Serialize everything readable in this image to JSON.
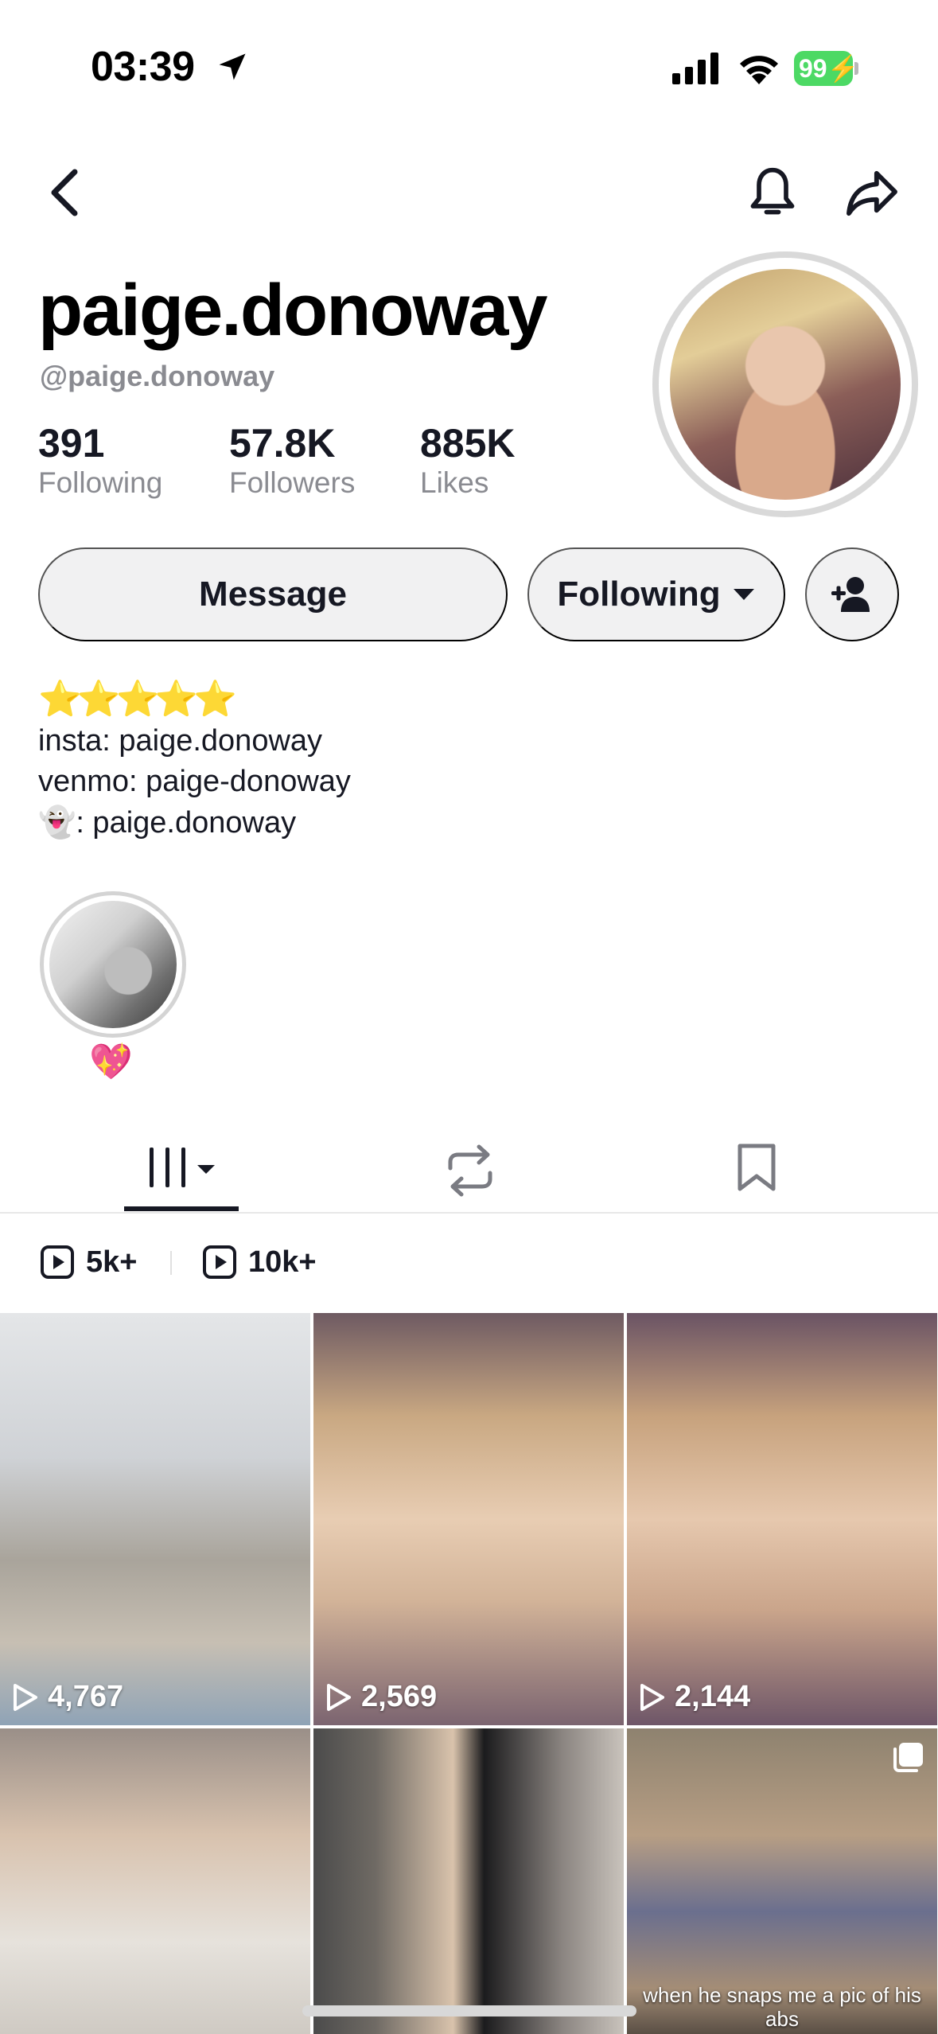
{
  "status_bar": {
    "time": "03:39",
    "battery": "99"
  },
  "profile": {
    "display_name": "paige.donoway",
    "handle": "@paige.donoway",
    "stats": [
      {
        "value": "391",
        "label": "Following"
      },
      {
        "value": "57.8K",
        "label": "Followers"
      },
      {
        "value": "885K",
        "label": "Likes"
      }
    ]
  },
  "actions": {
    "message_label": "Message",
    "following_label": "Following"
  },
  "bio": {
    "stars": "⭐⭐⭐⭐⭐",
    "lines": [
      "insta: paige.donoway",
      "venmo: paige-donoway",
      "👻: paige.donoway"
    ]
  },
  "highlight": {
    "emoji": "💖"
  },
  "filters": [
    {
      "label": "5k+"
    },
    {
      "label": "10k+"
    }
  ],
  "videos": [
    {
      "views": "4,767"
    },
    {
      "views": "2,569"
    },
    {
      "views": "2,144"
    },
    {
      "views": ""
    },
    {
      "views": ""
    },
    {
      "views": "",
      "caption": "when he snaps me a pic of his abs"
    }
  ],
  "colors": {
    "accent_text": "#161823",
    "muted": "#8a8b91",
    "pill_bg": "#f1f1f2",
    "battery": "#4cd964"
  }
}
